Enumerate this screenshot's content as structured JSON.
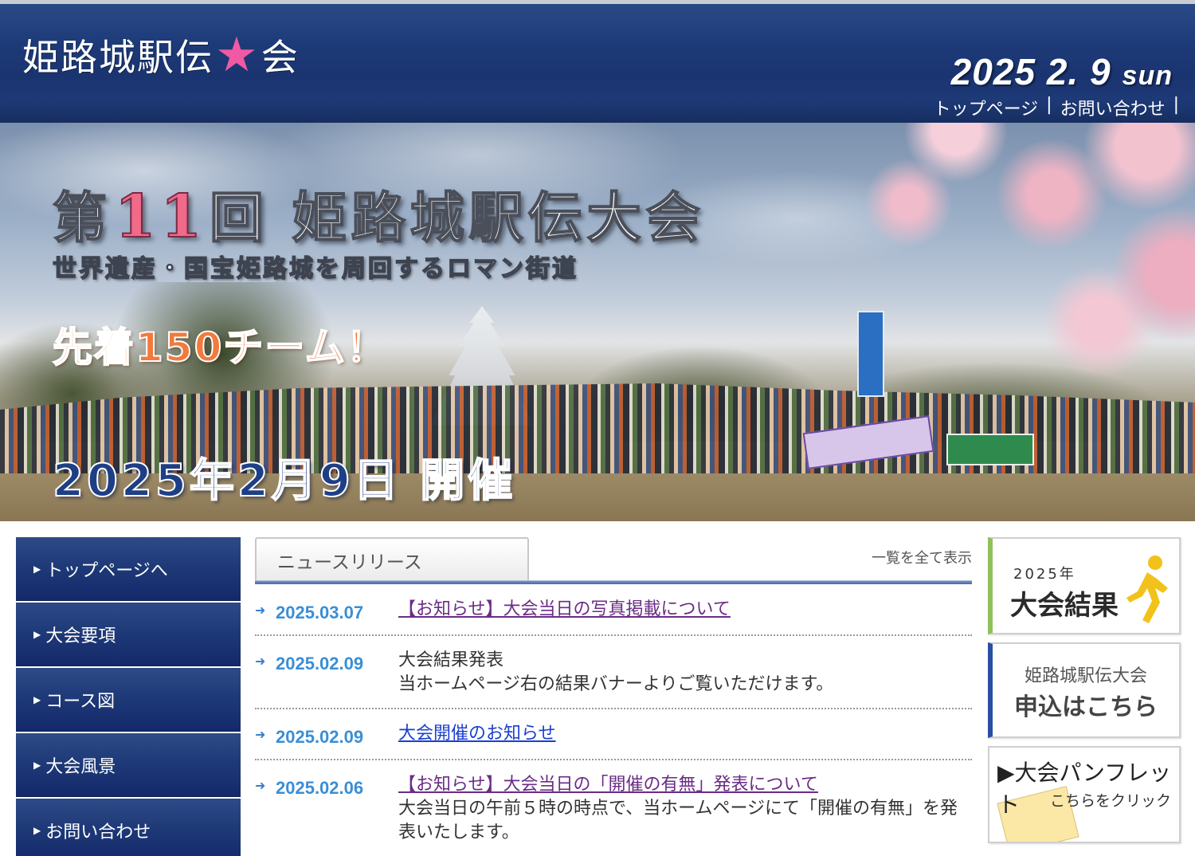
{
  "header": {
    "logo_text": "姫路城駅伝",
    "logo_star": "★",
    "logo_suffix": "会",
    "date_main": "2025  2. 9",
    "date_dow": "sun",
    "links": [
      "トップページ",
      "お問い合わせ"
    ],
    "link_separator": "|"
  },
  "hero": {
    "title_prefix": "第",
    "title_number": "11",
    "title_suffix": "回 姫路城駅伝大会",
    "subtitle": "世界遺産・国宝姫路城を周回するロマン街道",
    "teams": "先着150チーム！",
    "event_date": "2025年2月9日 開催"
  },
  "nav": {
    "items": [
      {
        "label": "トップページへ"
      },
      {
        "label": "大会要項"
      },
      {
        "label": "コース図"
      },
      {
        "label": "大会風景"
      },
      {
        "label": "お問い合わせ"
      }
    ],
    "bullet": "▶"
  },
  "news": {
    "tab_label": "ニュースリリース",
    "view_all": "一覧を全て表示",
    "arrow": "➜",
    "items": [
      {
        "date": "2025.03.07",
        "title": "【お知らせ】大会当日の写真掲載について",
        "body": ""
      },
      {
        "date": "2025.02.09",
        "title": "大会結果発表",
        "body": "当ホームページ右の結果バナーよりご覧いただけます。"
      },
      {
        "date": "2025.02.09",
        "title": "大会開催のお知らせ",
        "body": ""
      },
      {
        "date": "2025.02.06",
        "title": "【お知らせ】大会当日の「開催の有無」発表について",
        "body": "大会当日の午前５時の時点で、当ホームページにて「開催の有無」を発表いたします。"
      }
    ]
  },
  "banners": {
    "results": {
      "year": "2025年",
      "label": "大会結果"
    },
    "apply": {
      "line1": "姫路城駅伝大会",
      "line2": "申込はこちら"
    },
    "pamphlet": {
      "line1": "▶大会パンフレット",
      "line2": "こちらをクリック"
    }
  },
  "colors": {
    "header_blue": "#1d3a78",
    "nav_blue": "#1f3a78",
    "accent_pink": "#ef5aa2",
    "date_blue": "#3a8ed6",
    "link_purple": "#6a2c86",
    "link_blue": "#1a3fcf",
    "results_green": "#8fc05a",
    "runner_yellow": "#f2c21a"
  }
}
